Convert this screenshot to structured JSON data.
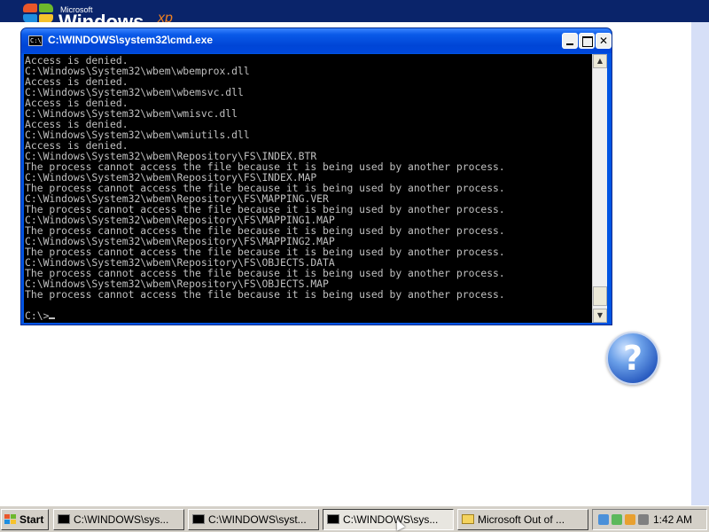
{
  "desktop": {
    "brand_ms": "Microsoft",
    "brand_windows": "Windows",
    "brand_xp": "xp"
  },
  "cmd_window": {
    "title": "C:\\WINDOWS\\system32\\cmd.exe",
    "sys_icon": "C:\\",
    "lines": [
      "Access is denied.",
      "C:\\Windows\\System32\\wbem\\wbemprox.dll",
      "Access is denied.",
      "C:\\Windows\\System32\\wbem\\wbemsvc.dll",
      "Access is denied.",
      "C:\\Windows\\System32\\wbem\\wmisvc.dll",
      "Access is denied.",
      "C:\\Windows\\System32\\wbem\\wmiutils.dll",
      "Access is denied.",
      "C:\\Windows\\System32\\wbem\\Repository\\FS\\INDEX.BTR",
      "The process cannot access the file because it is being used by another process.",
      "C:\\Windows\\System32\\wbem\\Repository\\FS\\INDEX.MAP",
      "The process cannot access the file because it is being used by another process.",
      "C:\\Windows\\System32\\wbem\\Repository\\FS\\MAPPING.VER",
      "The process cannot access the file because it is being used by another process.",
      "C:\\Windows\\System32\\wbem\\Repository\\FS\\MAPPING1.MAP",
      "The process cannot access the file because it is being used by another process.",
      "C:\\Windows\\System32\\wbem\\Repository\\FS\\MAPPING2.MAP",
      "The process cannot access the file because it is being used by another process.",
      "C:\\Windows\\System32\\wbem\\Repository\\FS\\OBJECTS.DATA",
      "The process cannot access the file because it is being used by another process.",
      "C:\\Windows\\System32\\wbem\\Repository\\FS\\OBJECTS.MAP",
      "The process cannot access the file because it is being used by another process."
    ],
    "prompt": "C:\\>",
    "buttons": {
      "minimize": "",
      "maximize": "",
      "close": "✕"
    }
  },
  "help": {
    "glyph": "?"
  },
  "taskbar": {
    "start_label": "Start",
    "tasks": [
      {
        "label": "C:\\WINDOWS\\sys...",
        "active": false,
        "icon": "cmd-icon"
      },
      {
        "label": "C:\\WINDOWS\\syst...",
        "active": false,
        "icon": "cmd-icon"
      },
      {
        "label": "C:\\WINDOWS\\sys...",
        "active": true,
        "icon": "cmd-icon"
      },
      {
        "label": "Microsoft Out of ...",
        "active": false,
        "icon": "app-icon"
      }
    ],
    "clock": "1:42 AM"
  },
  "colors": {
    "titlebar": "#0054e3",
    "console_bg": "#000000",
    "console_text": "#c0c0c0",
    "taskbar": "#d4d0c8"
  }
}
